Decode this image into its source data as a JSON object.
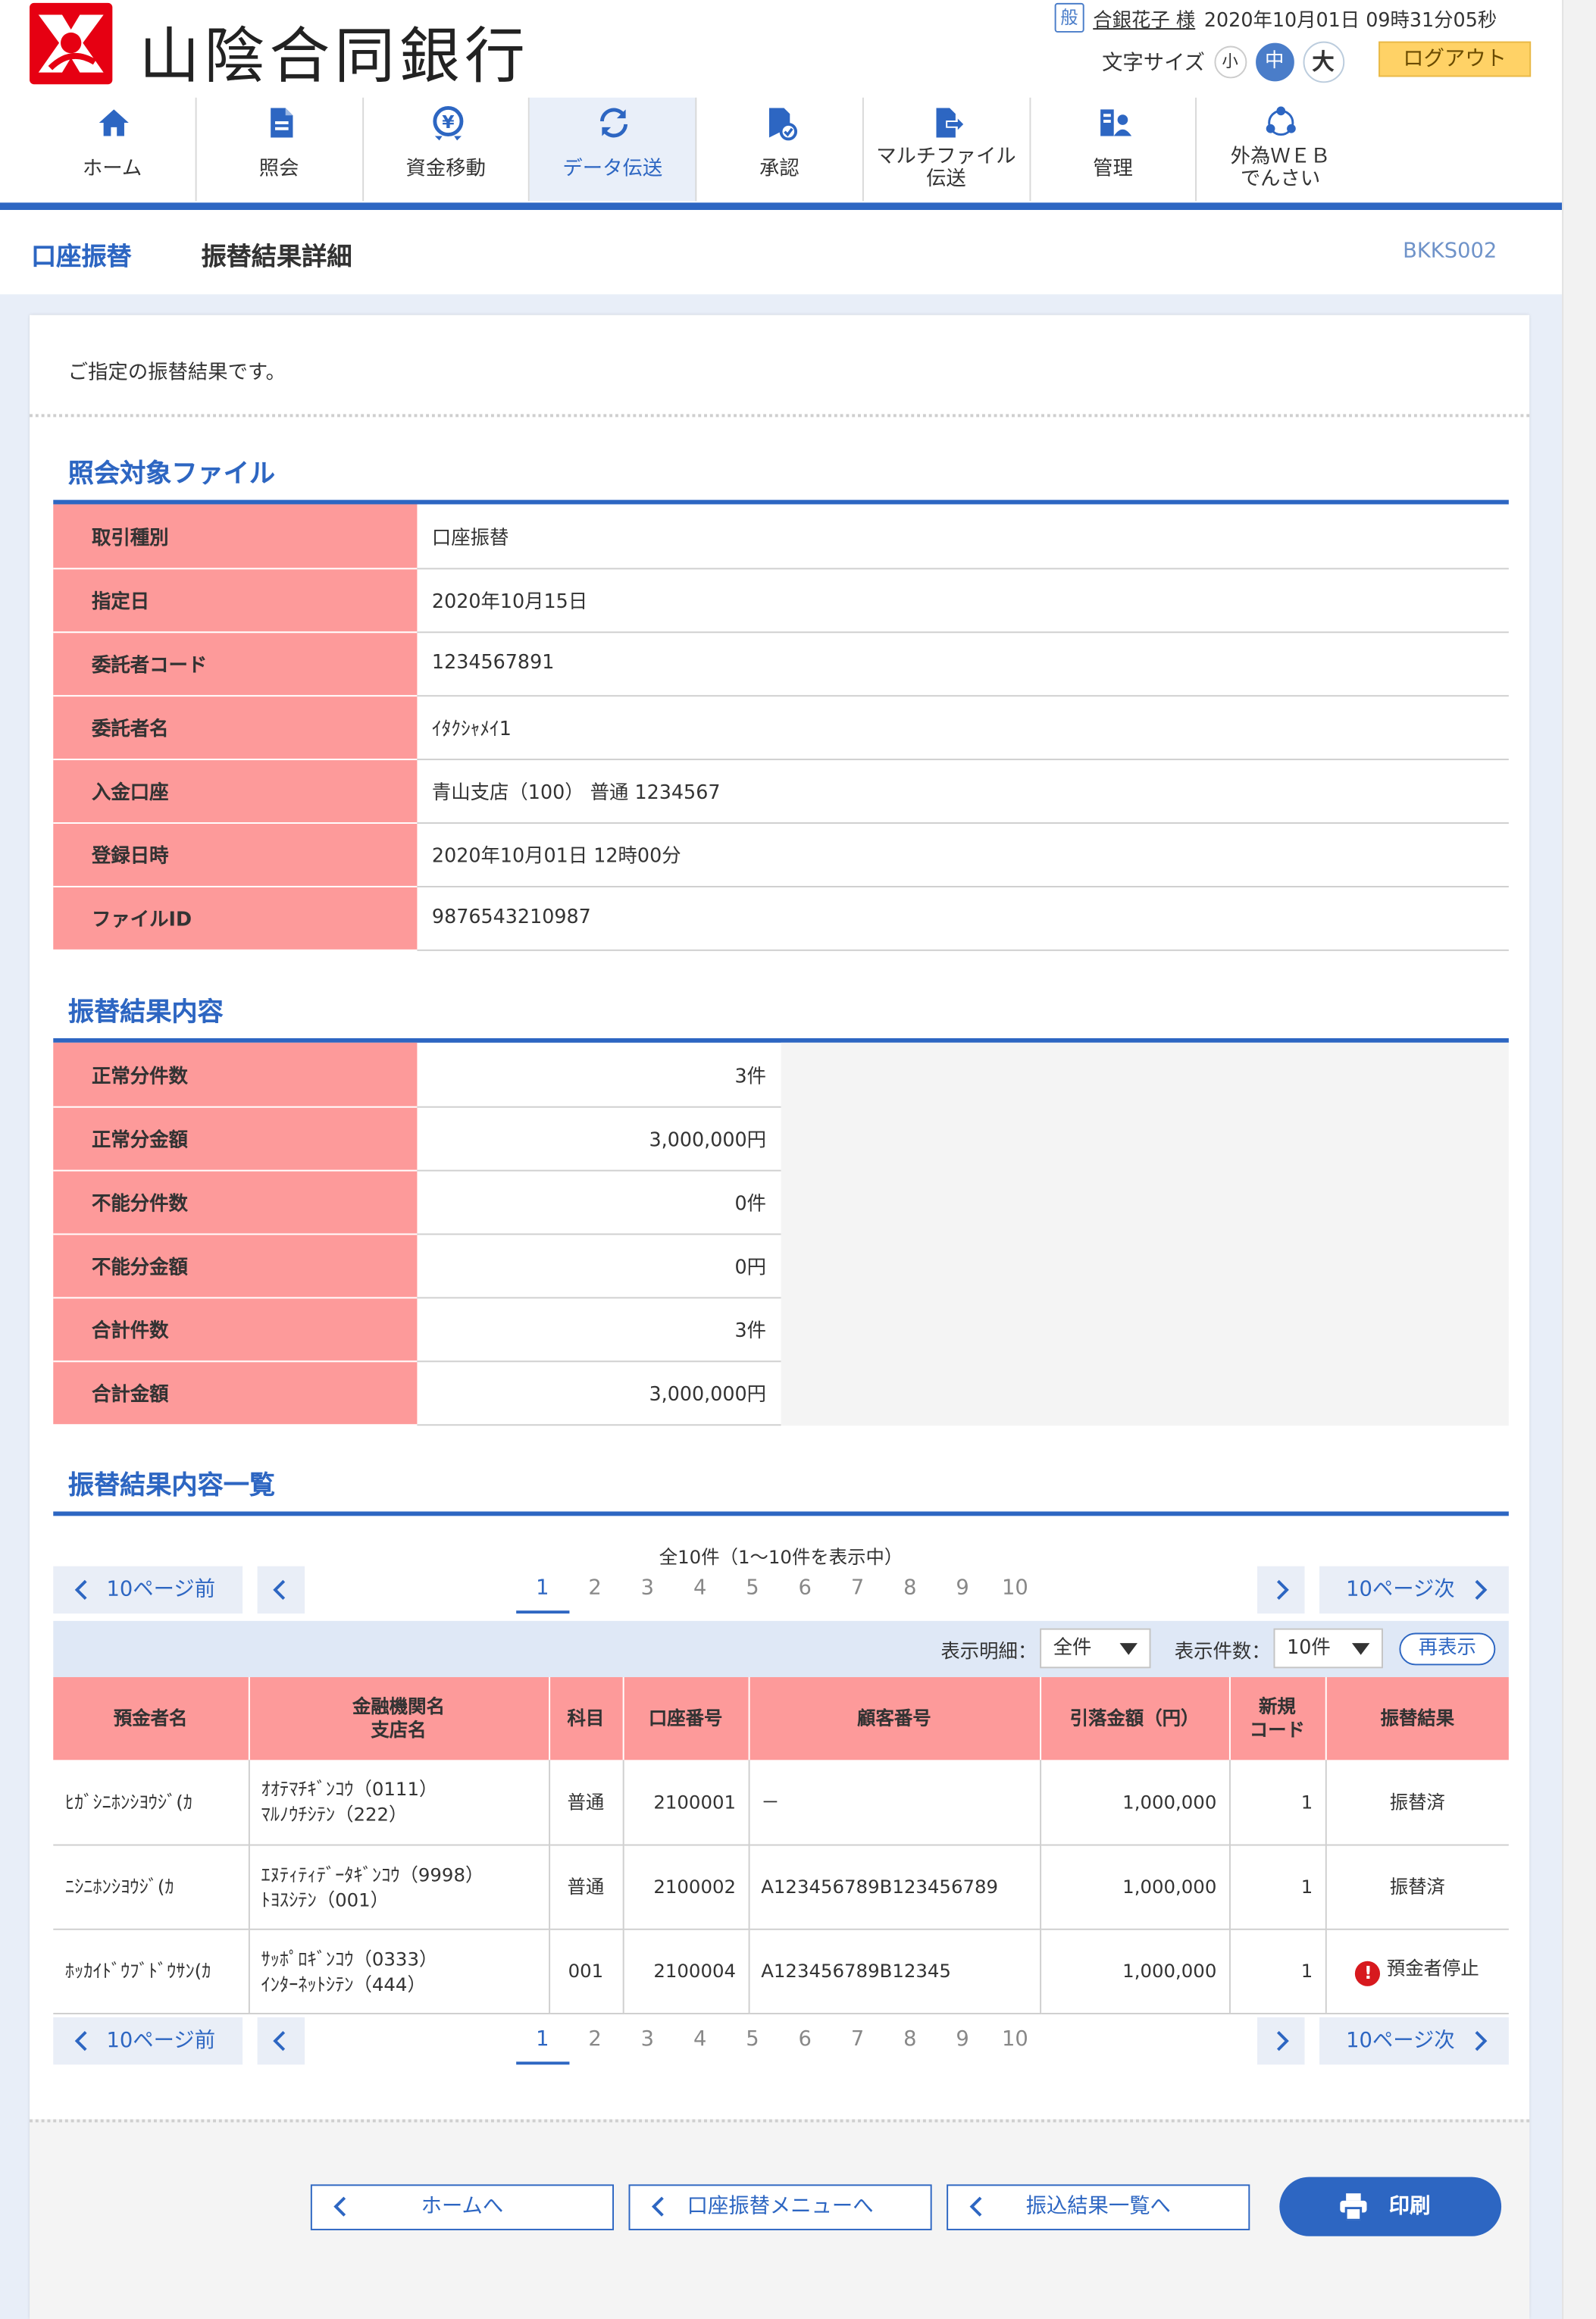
{
  "header": {
    "bank_name": "山陰合同銀行",
    "user_kind_badge": "般",
    "user_name": "合銀花子 様",
    "datetime": "2020年10月01日 09時31分05秒",
    "font_size_label": "文字サイズ",
    "font_sizes": [
      "小",
      "中",
      "大"
    ],
    "logout": "ログアウト"
  },
  "nav": {
    "items": [
      {
        "label": "ホーム",
        "icon": "home-icon"
      },
      {
        "label": "照会",
        "icon": "document-icon"
      },
      {
        "label": "資金移動",
        "icon": "yen-transfer-icon"
      },
      {
        "label": "データ伝送",
        "icon": "sync-icon"
      },
      {
        "label": "承認",
        "icon": "approve-document-icon"
      },
      {
        "label_1": "マルチファイル",
        "label_2": "伝送",
        "icon": "file-send-icon"
      },
      {
        "label": "管理",
        "icon": "admin-icon"
      },
      {
        "label_1": "外為ＷＥＢ",
        "label_2": "でんさい",
        "icon": "network-icon"
      }
    ],
    "active": "データ伝送"
  },
  "title": {
    "crumb": "口座振替",
    "page": "振替結果詳細",
    "screen_id": "BKKS002"
  },
  "lead": "ご指定の振替結果です。",
  "file_section": {
    "title": "照会対象ファイル",
    "rows": [
      {
        "label": "取引種別",
        "value": "口座振替"
      },
      {
        "label": "指定日",
        "value": "2020年10月15日"
      },
      {
        "label": "委託者コード",
        "value": "1234567891"
      },
      {
        "label": "委託者名",
        "value": "ｲﾀｸｼｬﾒｲ1"
      },
      {
        "label": "入金口座",
        "value": "青山支店（100） 普通 1234567"
      },
      {
        "label": "登録日時",
        "value": "2020年10月01日 12時00分"
      },
      {
        "label": "ファイルID",
        "value": "9876543210987"
      }
    ]
  },
  "summary_section": {
    "title": "振替結果内容",
    "rows": [
      {
        "label": "正常分件数",
        "value": "3件"
      },
      {
        "label": "正常分金額",
        "value": "3,000,000円"
      },
      {
        "label": "不能分件数",
        "value": "0件"
      },
      {
        "label": "不能分金額",
        "value": "0円"
      },
      {
        "label": "合計件数",
        "value": "3件"
      },
      {
        "label": "合計金額",
        "value": "3,000,000円"
      }
    ]
  },
  "list_section": {
    "title": "振替結果内容一覧",
    "count_text": "全10件（1～10件を表示中）",
    "pager": {
      "prev10": "10ページ前",
      "next10": "10ページ次",
      "pages": [
        "1",
        "2",
        "3",
        "4",
        "5",
        "6",
        "7",
        "8",
        "9",
        "10"
      ],
      "current": "1"
    },
    "filter": {
      "detail_label": "表示明細：",
      "detail_value": "全件",
      "count_label": "表示件数：",
      "count_value": "10件",
      "redisplay": "再表示"
    },
    "columns": {
      "depositor": "預金者名",
      "bank_1": "金融機関名",
      "bank_2": "支店名",
      "subject": "科目",
      "account": "口座番号",
      "customer": "顧客番号",
      "amount": "引落金額（円）",
      "new_code_1": "新規",
      "new_code_2": "コード",
      "result": "振替結果"
    },
    "rows": [
      {
        "depositor": "ﾋｶﾞｼﾆﾎﾝｼﾖｳｼﾞ(ｶ",
        "bank": "ｵｵﾃﾏﾁｷﾞﾝｺｳ（0111）",
        "branch": "ﾏﾙﾉｳﾁｼﾃﾝ（222）",
        "subject": "普通",
        "account": "2100001",
        "customer": "－",
        "amount": "1,000,000",
        "new_code": "1",
        "result": "振替済"
      },
      {
        "depositor": "ﾆｼﾆﾎﾝｼﾖｳｼﾞ(ｶ",
        "bank": "ｴﾇﾃｨﾃｨﾃﾞｰﾀｷﾞﾝｺｳ（9998）",
        "branch": "ﾄﾖｽｼﾃﾝ（001）",
        "subject": "普通",
        "account": "2100002",
        "customer": "A123456789B123456789",
        "amount": "1,000,000",
        "new_code": "1",
        "result": "振替済"
      },
      {
        "depositor": "ﾎｯｶｲﾄﾞｳﾌﾞﾄﾞｳｻﾝ(ｶ",
        "bank": "ｻｯﾎﾟﾛｷﾞﾝｺｳ（0333）",
        "branch": "ｲﾝﾀｰﾈｯﾄｼﾃﾝ（444）",
        "subject": "001",
        "account": "2100004",
        "customer": "A123456789B12345",
        "amount": "1,000,000",
        "new_code": "1",
        "result": "預金者停止"
      }
    ]
  },
  "footer": {
    "home": "ホームへ",
    "menu": "口座振替メニューへ",
    "list": "振込結果一覧へ",
    "print": "印刷"
  },
  "colors": {
    "accent": "#2d66c2",
    "label_bg": "#fd9a9a",
    "logout_bg": "#ffd266",
    "warning": "#d7191e"
  }
}
